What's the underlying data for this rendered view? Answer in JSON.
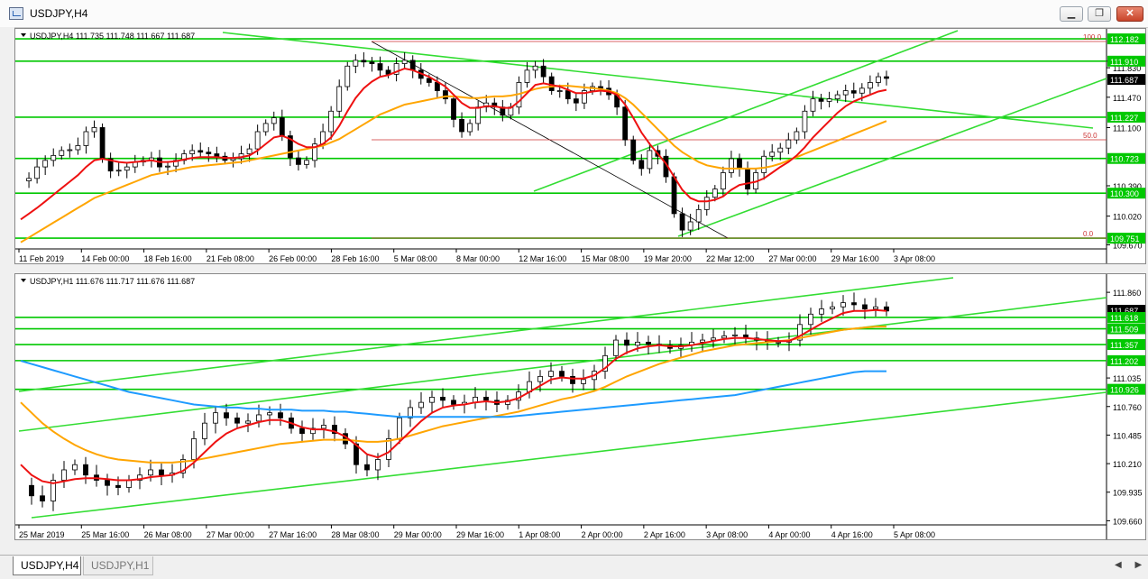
{
  "window": {
    "title": "USDJPY,H4",
    "icon": "chart-window-icon"
  },
  "window_buttons": {
    "minimize": "▁",
    "restore": "❐",
    "close": "✕"
  },
  "chart_data": [
    {
      "type": "candlestick",
      "symbol_info": "USDJPY,H4  111.735 111.748 111.667 111.687",
      "price_axis": [
        "111.910",
        "111.830",
        "111.470",
        "111.100",
        "110.390",
        "110.020",
        "109.670"
      ],
      "highlighted_levels": [
        {
          "label": "112.182",
          "value": 112.182,
          "color": "#00c800"
        },
        {
          "label": "111.910",
          "value": 111.91,
          "color": "#00c800"
        },
        {
          "label": "111.687",
          "value": 111.687,
          "color": "#000000"
        },
        {
          "label": "111.227",
          "value": 111.227,
          "color": "#00c800"
        },
        {
          "label": "110.723",
          "value": 110.723,
          "color": "#00c800"
        },
        {
          "label": "110.300",
          "value": 110.3,
          "color": "#00c800"
        },
        {
          "label": "109.751",
          "value": 109.751,
          "color": "#00c800"
        }
      ],
      "fib_labels": [
        "100.0",
        "50.0",
        "0.0"
      ],
      "time_axis": [
        "11 Feb 2019",
        "14 Feb 00:00",
        "18 Feb 16:00",
        "21 Feb 08:00",
        "26 Feb 00:00",
        "28 Feb 16:00",
        "5 Mar 08:00",
        "8 Mar 00:00",
        "12 Mar 16:00",
        "15 Mar 08:00",
        "19 Mar 20:00",
        "22 Mar 12:00",
        "27 Mar 00:00",
        "29 Mar 16:00",
        "3 Apr 08:00"
      ],
      "y_range": [
        109.62,
        112.26
      ],
      "close_path": [
        110.45,
        110.48,
        110.62,
        110.7,
        110.76,
        110.82,
        110.83,
        110.88,
        111.05,
        111.1,
        110.72,
        110.57,
        110.58,
        110.62,
        110.68,
        110.7,
        110.73,
        110.62,
        110.63,
        110.7,
        110.78,
        110.82,
        110.8,
        110.78,
        110.75,
        110.7,
        110.72,
        110.78,
        110.84,
        111.05,
        111.15,
        111.22,
        111.0,
        110.73,
        110.65,
        110.7,
        110.9,
        111.05,
        111.3,
        111.6,
        111.85,
        111.92,
        111.9,
        111.88,
        111.8,
        111.75,
        111.88,
        111.92,
        111.8,
        111.7,
        111.65,
        111.55,
        111.45,
        111.2,
        111.05,
        111.15,
        111.35,
        111.4,
        111.35,
        111.25,
        111.35,
        111.65,
        111.8,
        111.85,
        111.72,
        111.55,
        111.55,
        111.45,
        111.4,
        111.55,
        111.6,
        111.58,
        111.5,
        111.35,
        110.95,
        110.7,
        110.6,
        110.82,
        110.75,
        110.5,
        110.05,
        109.85,
        109.95,
        110.1,
        110.25,
        110.35,
        110.55,
        110.72,
        110.6,
        110.35,
        110.55,
        110.75,
        110.8,
        110.85,
        110.95,
        111.05,
        111.3,
        111.45,
        111.42,
        111.45,
        111.5,
        111.55,
        111.52,
        111.58,
        111.65,
        111.72,
        111.7
      ],
      "ma_red": [
        109.98,
        110.05,
        110.12,
        110.2,
        110.28,
        110.36,
        110.44,
        110.52,
        110.62,
        110.7,
        110.72,
        110.7,
        110.68,
        110.67,
        110.68,
        110.69,
        110.7,
        110.68,
        110.68,
        110.69,
        110.71,
        110.73,
        110.74,
        110.74,
        110.74,
        110.73,
        110.73,
        110.74,
        110.76,
        110.82,
        110.9,
        110.98,
        111.0,
        110.96,
        110.9,
        110.86,
        110.86,
        110.9,
        110.98,
        111.12,
        111.3,
        111.46,
        111.58,
        111.66,
        111.72,
        111.74,
        111.78,
        111.82,
        111.8,
        111.76,
        111.72,
        111.66,
        111.6,
        111.5,
        111.4,
        111.34,
        111.34,
        111.36,
        111.36,
        111.34,
        111.34,
        111.42,
        111.52,
        111.62,
        111.64,
        111.62,
        111.6,
        111.56,
        111.52,
        111.52,
        111.54,
        111.55,
        111.54,
        111.5,
        111.38,
        111.22,
        111.04,
        110.9,
        110.78,
        110.66,
        110.5,
        110.34,
        110.24,
        110.2,
        110.2,
        110.22,
        110.26,
        110.34,
        110.4,
        110.42,
        110.44,
        110.48,
        110.55,
        110.62,
        110.68,
        110.76,
        110.86,
        110.98,
        111.08,
        111.18,
        111.28,
        111.36,
        111.42,
        111.46,
        111.5,
        111.54,
        111.56
      ],
      "ma_orange": [
        109.7,
        109.76,
        109.82,
        109.88,
        109.94,
        110.0,
        110.06,
        110.12,
        110.18,
        110.24,
        110.28,
        110.32,
        110.36,
        110.4,
        110.44,
        110.48,
        110.52,
        110.54,
        110.56,
        110.58,
        110.6,
        110.62,
        110.63,
        110.64,
        110.65,
        110.66,
        110.67,
        110.68,
        110.7,
        110.72,
        110.74,
        110.76,
        110.78,
        110.8,
        110.82,
        110.84,
        110.86,
        110.88,
        110.92,
        110.96,
        111.02,
        111.08,
        111.14,
        111.2,
        111.26,
        111.3,
        111.34,
        111.38,
        111.4,
        111.42,
        111.44,
        111.46,
        111.48,
        111.48,
        111.47,
        111.46,
        111.46,
        111.47,
        111.48,
        111.48,
        111.49,
        111.51,
        111.54,
        111.57,
        111.59,
        111.6,
        111.61,
        111.61,
        111.6,
        111.59,
        111.58,
        111.57,
        111.55,
        111.52,
        111.46,
        111.38,
        111.28,
        111.18,
        111.08,
        110.98,
        110.88,
        110.8,
        110.74,
        110.68,
        110.64,
        110.62,
        110.6,
        110.6,
        110.6,
        110.6,
        110.6,
        110.61,
        110.63,
        110.66,
        110.7,
        110.74,
        110.78,
        110.82,
        110.86,
        110.9,
        110.94,
        110.98,
        111.02,
        111.06,
        111.1,
        111.14,
        111.18
      ]
    },
    {
      "type": "candlestick",
      "symbol_info": "USDJPY,H1  111.676 111.717 111.676 111.687",
      "price_axis": [
        "111.860",
        "111.035",
        "110.760",
        "110.485",
        "110.210",
        "109.935",
        "109.660"
      ],
      "highlighted_levels": [
        {
          "label": "111.687",
          "value": 111.687,
          "color": "#000000"
        },
        {
          "label": "111.618",
          "value": 111.618,
          "color": "#00c800"
        },
        {
          "label": "111.509",
          "value": 111.509,
          "color": "#00c800"
        },
        {
          "label": "111.357",
          "value": 111.357,
          "color": "#00c800"
        },
        {
          "label": "111.202",
          "value": 111.202,
          "color": "#00c800"
        },
        {
          "label": "110.926",
          "value": 110.926,
          "color": "#00c800"
        }
      ],
      "time_axis": [
        "25 Mar 2019",
        "25 Mar 16:00",
        "26 Mar 08:00",
        "27 Mar 00:00",
        "27 Mar 16:00",
        "28 Mar 08:00",
        "29 Mar 00:00",
        "29 Mar 16:00",
        "1 Apr 08:00",
        "2 Apr 00:00",
        "2 Apr 16:00",
        "3 Apr 08:00",
        "4 Apr 00:00",
        "4 Apr 16:00",
        "5 Apr 08:00"
      ],
      "y_range": [
        109.62,
        112.0
      ],
      "close_path": [
        110.0,
        109.9,
        109.85,
        110.05,
        110.15,
        110.2,
        110.1,
        110.05,
        110.0,
        109.98,
        110.05,
        110.1,
        110.15,
        110.1,
        110.12,
        110.25,
        110.45,
        110.6,
        110.7,
        110.65,
        110.6,
        110.62,
        110.68,
        110.7,
        110.65,
        110.55,
        110.5,
        110.55,
        110.58,
        110.5,
        110.4,
        110.2,
        110.15,
        110.25,
        110.45,
        110.65,
        110.75,
        110.8,
        110.85,
        110.82,
        110.78,
        110.8,
        110.85,
        110.82,
        110.78,
        110.82,
        110.9,
        111.0,
        111.05,
        111.1,
        111.05,
        110.98,
        111.02,
        111.1,
        111.25,
        111.4,
        111.35,
        111.38,
        111.36,
        111.35,
        111.32,
        111.35,
        111.38,
        111.4,
        111.42,
        111.44,
        111.45,
        111.42,
        111.4,
        111.38,
        111.38,
        111.4,
        111.55,
        111.65,
        111.7,
        111.72,
        111.76,
        111.74,
        111.7,
        111.72,
        111.68
      ],
      "ma_red": [
        110.2,
        110.1,
        110.04,
        110.02,
        110.04,
        110.06,
        110.07,
        110.07,
        110.06,
        110.05,
        110.05,
        110.06,
        110.08,
        110.09,
        110.1,
        110.14,
        110.22,
        110.32,
        110.42,
        110.5,
        110.55,
        110.58,
        110.61,
        110.63,
        110.63,
        110.6,
        110.56,
        110.54,
        110.54,
        110.52,
        110.47,
        110.39,
        110.3,
        110.27,
        110.32,
        110.42,
        110.52,
        110.62,
        110.7,
        110.75,
        110.77,
        110.78,
        110.8,
        110.81,
        110.8,
        110.81,
        110.84,
        110.9,
        110.96,
        111.02,
        111.04,
        111.03,
        111.03,
        111.06,
        111.13,
        111.22,
        111.28,
        111.32,
        111.34,
        111.35,
        111.34,
        111.34,
        111.35,
        111.37,
        111.39,
        111.41,
        111.42,
        111.42,
        111.41,
        111.4,
        111.39,
        111.39,
        111.44,
        111.5,
        111.56,
        111.61,
        111.66,
        111.68,
        111.68,
        111.69,
        111.68
      ],
      "ma_orange": [
        110.8,
        110.7,
        110.6,
        110.52,
        110.45,
        110.39,
        110.34,
        110.3,
        110.27,
        110.25,
        110.24,
        110.23,
        110.22,
        110.22,
        110.22,
        110.23,
        110.24,
        110.26,
        110.28,
        110.3,
        110.32,
        110.34,
        110.36,
        110.38,
        110.4,
        110.41,
        110.42,
        110.43,
        110.44,
        110.44,
        110.44,
        110.43,
        110.42,
        110.42,
        110.43,
        110.45,
        110.48,
        110.51,
        110.54,
        110.57,
        110.59,
        110.61,
        110.63,
        110.65,
        110.67,
        110.69,
        110.71,
        110.74,
        110.77,
        110.8,
        110.83,
        110.85,
        110.88,
        110.91,
        110.95,
        111.0,
        111.05,
        111.09,
        111.13,
        111.17,
        111.2,
        111.23,
        111.26,
        111.29,
        111.31,
        111.33,
        111.35,
        111.36,
        111.37,
        111.38,
        111.39,
        111.4,
        111.42,
        111.44,
        111.46,
        111.48,
        111.5,
        111.51,
        111.52,
        111.53,
        111.53
      ],
      "ma_blue": [
        111.2,
        111.17,
        111.14,
        111.11,
        111.08,
        111.05,
        111.02,
        110.99,
        110.96,
        110.93,
        110.9,
        110.88,
        110.86,
        110.84,
        110.82,
        110.8,
        110.78,
        110.77,
        110.76,
        110.75,
        110.75,
        110.74,
        110.74,
        110.73,
        110.73,
        110.73,
        110.72,
        110.72,
        110.72,
        110.71,
        110.71,
        110.7,
        110.69,
        110.68,
        110.67,
        110.66,
        110.66,
        110.66,
        110.66,
        110.66,
        110.66,
        110.66,
        110.66,
        110.66,
        110.66,
        110.66,
        110.67,
        110.68,
        110.69,
        110.7,
        110.71,
        110.72,
        110.73,
        110.74,
        110.75,
        110.76,
        110.77,
        110.78,
        110.79,
        110.8,
        110.81,
        110.82,
        110.83,
        110.84,
        110.85,
        110.86,
        110.87,
        110.89,
        110.91,
        110.93,
        110.95,
        110.97,
        110.99,
        111.01,
        111.03,
        111.05,
        111.07,
        111.09,
        111.1,
        111.1,
        111.1
      ]
    }
  ],
  "tabs": [
    {
      "label": "USDJPY,H4",
      "active": true
    },
    {
      "label": "USDJPY,H1",
      "active": false
    }
  ],
  "tab_scroll": "◀ ▶"
}
